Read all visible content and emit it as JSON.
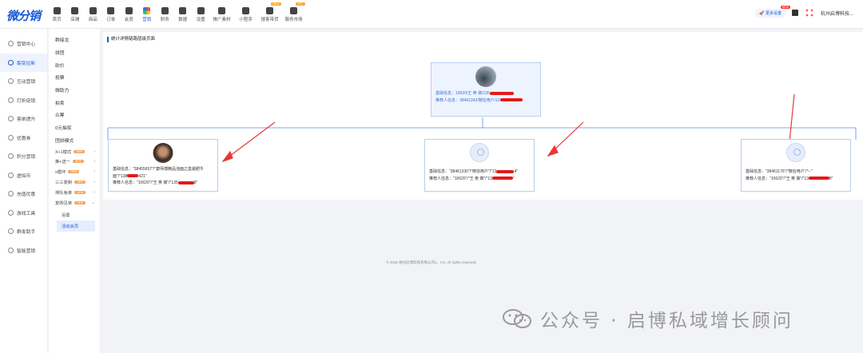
{
  "app": {
    "logo": "微分销",
    "company": "杭州启博科技...",
    "promo": "更多设置",
    "promo_badge": "NEW"
  },
  "nav": [
    {
      "label": "首页",
      "icon": "home-icon"
    },
    {
      "label": "店铺",
      "icon": "shop-icon"
    },
    {
      "label": "商品",
      "icon": "goods-icon"
    },
    {
      "label": "订单",
      "icon": "order-icon"
    },
    {
      "label": "会员",
      "icon": "member-icon"
    },
    {
      "label": "营销",
      "icon": "marketing-icon",
      "active": true
    },
    {
      "label": "财务",
      "icon": "finance-icon"
    },
    {
      "label": "数据",
      "icon": "data-icon"
    },
    {
      "label": "设置",
      "icon": "settings-icon"
    },
    {
      "label": "推广素材",
      "icon": "share-icon"
    },
    {
      "label": "小程序",
      "icon": "miniapp-icon"
    },
    {
      "label": "搜客带货",
      "icon": "live-icon",
      "badge": "NEW"
    },
    {
      "label": "服务市场",
      "icon": "market-icon",
      "badge": "HOT"
    }
  ],
  "side1": [
    "营销中心",
    "裂变拉新",
    "互动营销",
    "打折促销",
    "客单提升",
    "优惠券",
    "积分营销",
    "虚拟币",
    "充值优惠",
    "游戏工具",
    "群发助手",
    "智能营销"
  ],
  "side1_active": 1,
  "side2": {
    "items": [
      "群接龙",
      "拼团",
      "砍价",
      "投票",
      "微助力",
      "拍卖",
      "众筹",
      "0元抽奖",
      "团拼模式"
    ],
    "subs": [
      {
        "label": "X+1模式",
        "tag": "NEW",
        "arrow": "›"
      },
      {
        "label": "推+送一",
        "tag": "NEW",
        "arrow": "›"
      },
      {
        "label": "x循环",
        "tag": "NEW",
        "arrow": "›"
      },
      {
        "label": "三三复制",
        "tag": "NEW",
        "arrow": "›"
      },
      {
        "label": "排队免单",
        "tag": "NEW",
        "arrow": "›"
      },
      {
        "label": "复购见单",
        "tag": "NEW",
        "arrow": "⌄"
      }
    ],
    "leaves": [
      "设置",
      "活动会员"
    ]
  },
  "page": {
    "breadcrumb": "统计详情链路层级页面"
  },
  "root": {
    "line1": "基础信息：10620/王 英 做/135",
    "line2": "推荐人信息：38461342/微信用户/13"
  },
  "children": [
    {
      "line1": "基础信息：\"38455657\"/\"康师傅精品泡面之盒装肥牛",
      "line1b": "面\"/\"138",
      "line1c": "421\"",
      "line2": "推荐人信息：\"10620\"/\"王 英 做\"/\"135",
      "line2c": "8\""
    },
    {
      "line1": "基础信息：\"38461330\"/\"微信用户\"/\"13",
      "line1c": "4\"",
      "line2": "推荐人信息：\"10620\"/\"王 英 做\"/\"13",
      "line2c": "\""
    },
    {
      "line1": "基础信息：\"38461176\"/\"微信用户\"/\"--\"",
      "line1c": "",
      "line2": "推荐人信息：\"10620\"/\"王 英 做\"/\"13",
      "line2c": "8\""
    }
  ],
  "footer": "© 2026 杭州启博科技有限公司1，Inc. All rights reserved.",
  "watermark": "公众号 · 启博私域增长顾问"
}
